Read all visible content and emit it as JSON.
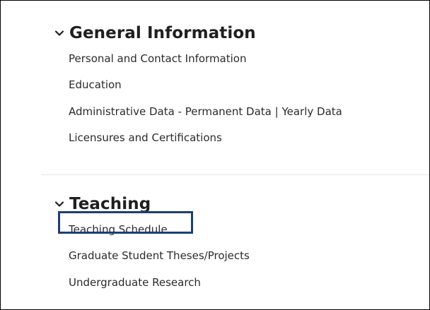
{
  "sections": [
    {
      "title": "General Information",
      "expanded_icon": "chevron-down-icon",
      "items": [
        {
          "label": "Personal and Contact Information"
        },
        {
          "label": "Education"
        },
        {
          "label": "Administrative Data - Permanent Data | Yearly Data"
        },
        {
          "label": "Licensures and Certifications"
        }
      ]
    },
    {
      "title": "Teaching",
      "expanded_icon": "chevron-down-icon",
      "items": [
        {
          "label": "Teaching Schedule",
          "highlighted": true
        },
        {
          "label": "Graduate Student Theses/Projects"
        },
        {
          "label": "Undergraduate Research"
        }
      ]
    }
  ],
  "colors": {
    "text": "#2b2b2b",
    "heading": "#1f1f1f",
    "highlight_border": "#1d3e73",
    "divider": "#e6e6e6"
  }
}
